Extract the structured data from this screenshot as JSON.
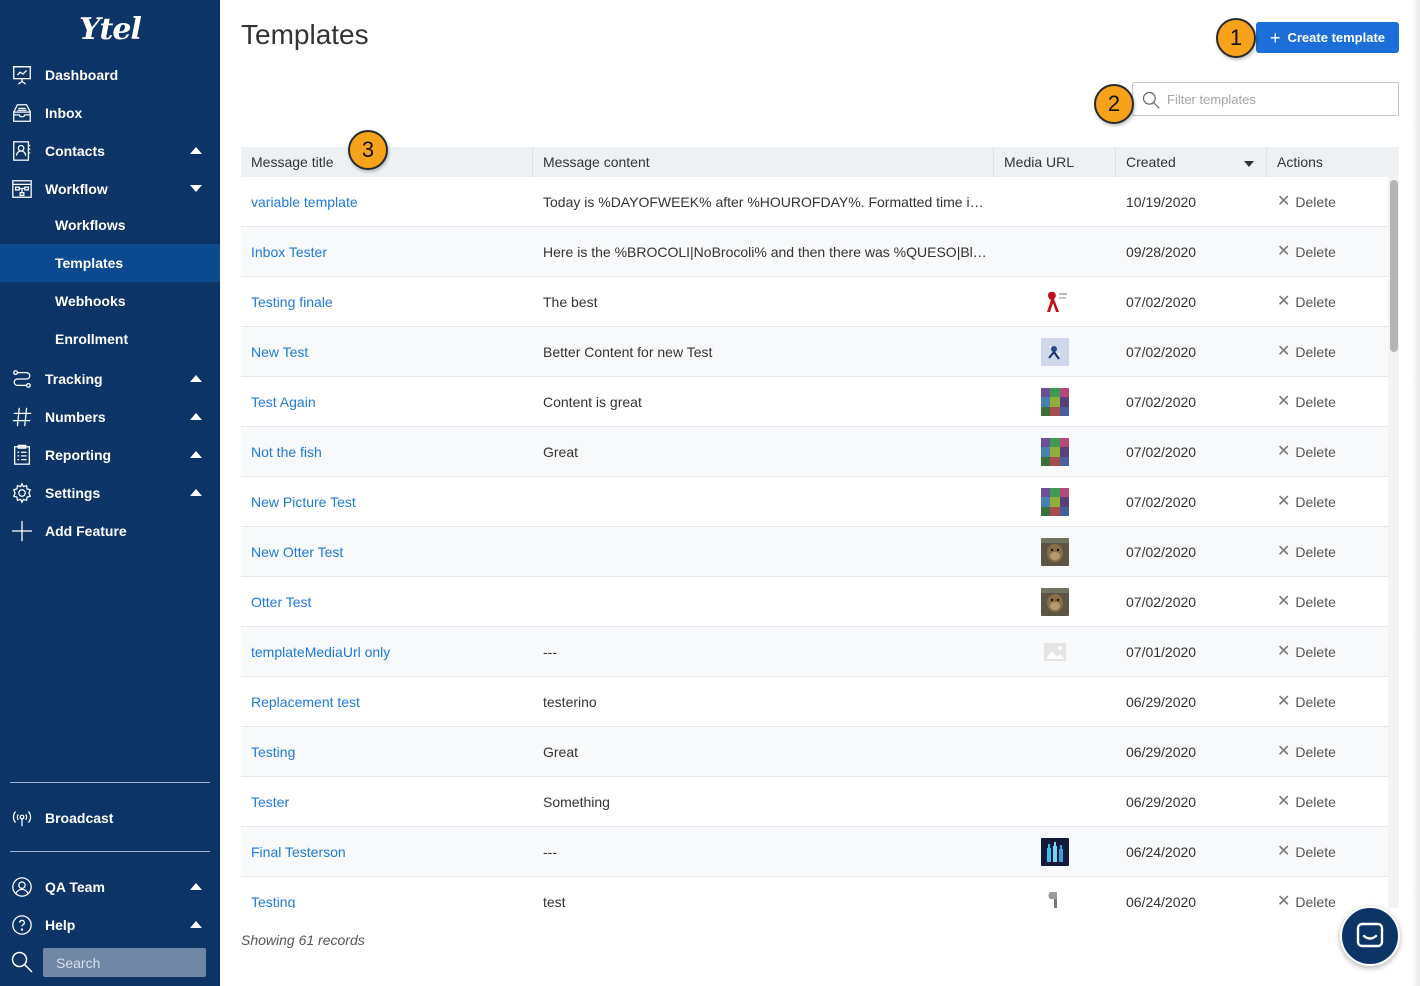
{
  "app": {
    "logo": "Ytel"
  },
  "sidebar": {
    "items": [
      {
        "label": "Dashboard",
        "icon": "dashboard-icon"
      },
      {
        "label": "Inbox",
        "icon": "inbox-icon"
      },
      {
        "label": "Contacts",
        "icon": "contacts-icon",
        "caret": "up"
      },
      {
        "label": "Workflow",
        "icon": "workflow-icon",
        "caret": "down"
      }
    ],
    "workflow_sub": [
      {
        "label": "Workflows",
        "active": false
      },
      {
        "label": "Templates",
        "active": true
      },
      {
        "label": "Webhooks",
        "active": false
      },
      {
        "label": "Enrollment",
        "active": false
      }
    ],
    "items_lower": [
      {
        "label": "Tracking",
        "icon": "tracking-icon",
        "caret": "up"
      },
      {
        "label": "Numbers",
        "icon": "hash-icon",
        "caret": "up"
      },
      {
        "label": "Reporting",
        "icon": "reporting-icon",
        "caret": "up"
      },
      {
        "label": "Settings",
        "icon": "gear-icon",
        "caret": "up"
      },
      {
        "label": "Add Feature",
        "icon": "plus-icon"
      }
    ],
    "broadcast": "Broadcast",
    "team": "QA Team",
    "help": "Help",
    "search_placeholder": "Search"
  },
  "main": {
    "title": "Templates",
    "create_button": "Create template",
    "filter_placeholder": "Filter templates",
    "badges": [
      "1",
      "2",
      "3"
    ],
    "columns": [
      "Message title",
      "Message content",
      "Media URL",
      "Created",
      "Actions"
    ],
    "rows": [
      {
        "title": "variable template",
        "content": "Today is %DAYOFWEEK% after %HOUROFDAY%. Formatted time is %TIME%",
        "media": "",
        "created": "10/19/2020",
        "action": "Delete"
      },
      {
        "title": "Inbox Tester",
        "content": "Here is the %BROCOLI|NoBrocoli% and then there was %QUESO|BlancoQueso%",
        "media": "",
        "created": "09/28/2020",
        "action": "Delete"
      },
      {
        "title": "Testing finale",
        "content": "The best",
        "media": "ribbon-image",
        "created": "07/02/2020",
        "action": "Delete"
      },
      {
        "title": "New Test",
        "content": "Better Content for new Test",
        "media": "figure-image",
        "created": "07/02/2020",
        "action": "Delete"
      },
      {
        "title": "Test Again",
        "content": "Content is great",
        "media": "mosaic-image",
        "created": "07/02/2020",
        "action": "Delete"
      },
      {
        "title": "Not the fish",
        "content": "Great",
        "media": "mosaic-image",
        "created": "07/02/2020",
        "action": "Delete"
      },
      {
        "title": "New Picture Test",
        "content": "",
        "media": "mosaic-image",
        "created": "07/02/2020",
        "action": "Delete"
      },
      {
        "title": "New Otter Test",
        "content": "",
        "media": "otter-image",
        "created": "07/02/2020",
        "action": "Delete"
      },
      {
        "title": "Otter Test",
        "content": "",
        "media": "otter-image",
        "created": "07/02/2020",
        "action": "Delete"
      },
      {
        "title": "templateMediaUrl only",
        "content": "---",
        "media": "placeholder-image",
        "created": "07/01/2020",
        "action": "Delete"
      },
      {
        "title": "Replacement test",
        "content": "testerino",
        "media": "",
        "created": "06/29/2020",
        "action": "Delete"
      },
      {
        "title": "Testing",
        "content": "Great",
        "media": "",
        "created": "06/29/2020",
        "action": "Delete"
      },
      {
        "title": "Tester",
        "content": "Something",
        "media": "",
        "created": "06/29/2020",
        "action": "Delete"
      },
      {
        "title": "Final Testerson",
        "content": "---",
        "media": "bottles-image",
        "created": "06/24/2020",
        "action": "Delete"
      },
      {
        "title": "Testing",
        "content": "test",
        "media": "axe-image",
        "created": "06/24/2020",
        "action": "Delete"
      }
    ],
    "records_text": "Showing 61 records"
  },
  "colors": {
    "sidebar": "#0d3466",
    "active": "#0b4a8e",
    "link": "#1e7ad6",
    "primary_button": "#1c6fd9",
    "badge": "#f7a21b"
  }
}
